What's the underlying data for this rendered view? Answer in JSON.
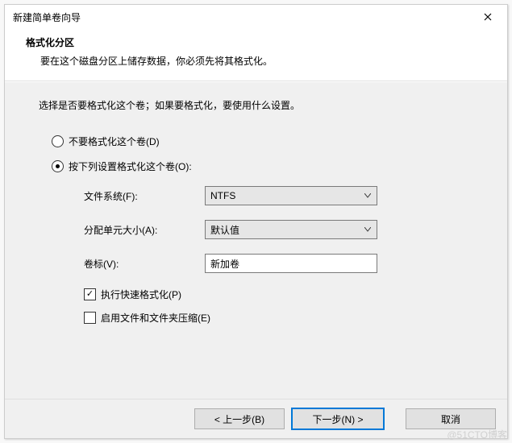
{
  "window": {
    "title": "新建简单卷向导"
  },
  "header": {
    "title": "格式化分区",
    "subtitle": "要在这个磁盘分区上储存数据，你必须先将其格式化。"
  },
  "body": {
    "description": "选择是否要格式化这个卷；如果要格式化，要使用什么设置。",
    "radio_no_format": "不要格式化这个卷(D)",
    "radio_do_format": "按下列设置格式化这个卷(O):",
    "label_filesystem": "文件系统(F):",
    "value_filesystem": "NTFS",
    "label_allocation": "分配单元大小(A):",
    "value_allocation": "默认值",
    "label_volume": "卷标(V):",
    "value_volume": "新加卷",
    "check_quick_format": "执行快速格式化(P)",
    "check_compression": "启用文件和文件夹压缩(E)"
  },
  "footer": {
    "back": "< 上一步(B)",
    "next": "下一步(N) >",
    "cancel": "取消"
  },
  "watermark": "@51CTO博客"
}
